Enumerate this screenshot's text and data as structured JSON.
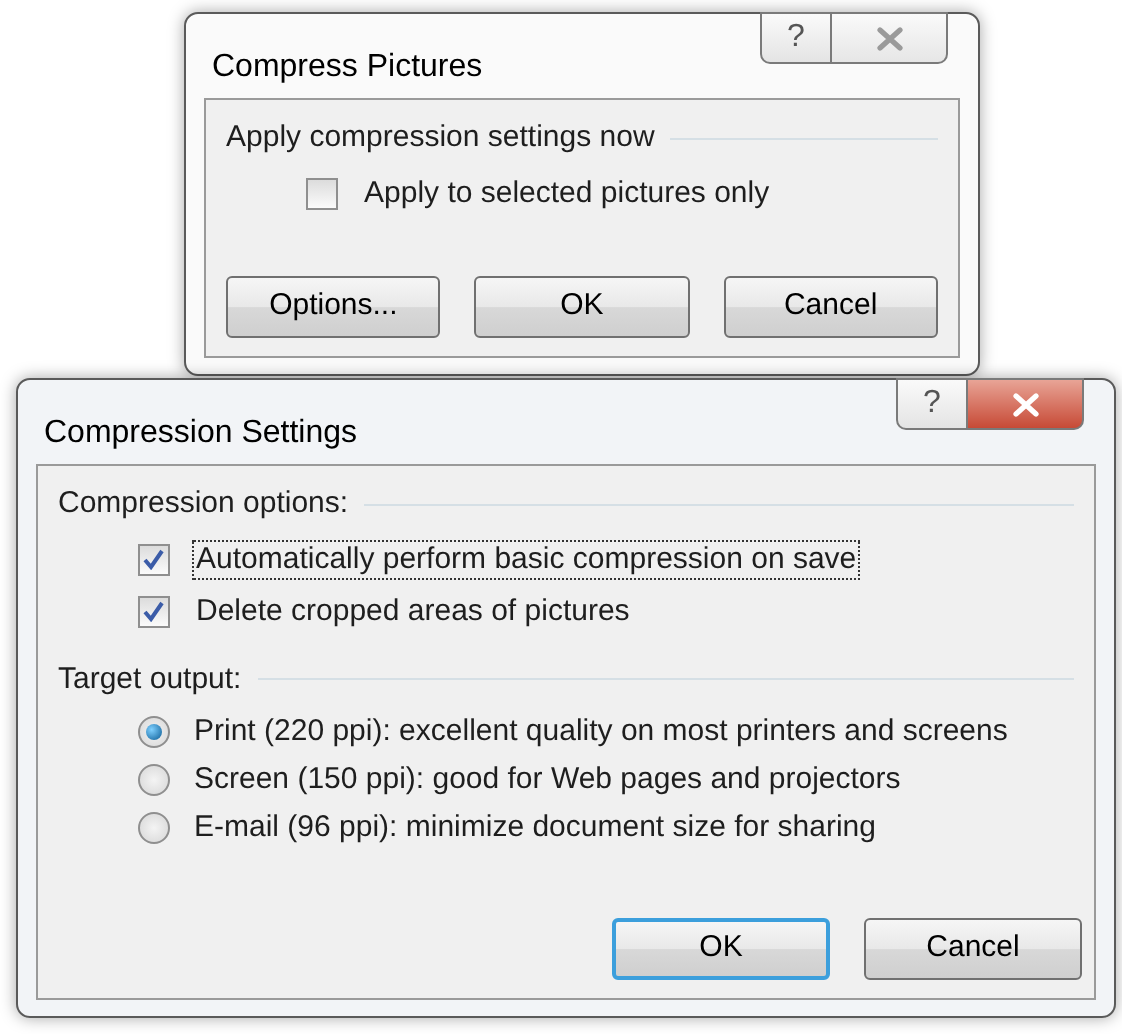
{
  "dialogs": [
    {
      "title": "Compress Pictures",
      "active": false,
      "help_button": "?",
      "groups": [
        {
          "label": "Apply compression settings now",
          "options": [
            {
              "kind": "checkbox",
              "label": "Apply to selected pictures only",
              "checked": false,
              "focused": false
            }
          ]
        }
      ],
      "buttons": [
        {
          "label": "Options...",
          "default": false
        },
        {
          "label": "OK",
          "default": false
        },
        {
          "label": "Cancel",
          "default": false
        }
      ]
    },
    {
      "title": "Compression Settings",
      "active": true,
      "help_button": "?",
      "groups": [
        {
          "label": "Compression options:",
          "options": [
            {
              "kind": "checkbox",
              "label": "Automatically perform basic compression on save",
              "checked": true,
              "focused": true
            },
            {
              "kind": "checkbox",
              "label": "Delete cropped areas of pictures",
              "checked": true,
              "focused": false
            }
          ]
        },
        {
          "label": "Target output:",
          "options": [
            {
              "kind": "radio",
              "label": "Print (220 ppi): excellent quality on most printers and screens",
              "selected": true
            },
            {
              "kind": "radio",
              "label": "Screen (150 ppi): good for Web pages and projectors",
              "selected": false
            },
            {
              "kind": "radio",
              "label": "E-mail (96 ppi): minimize document size for sharing",
              "selected": false
            }
          ]
        }
      ],
      "buttons": [
        {
          "label": "OK",
          "default": true
        },
        {
          "label": "Cancel",
          "default": false
        }
      ]
    }
  ]
}
